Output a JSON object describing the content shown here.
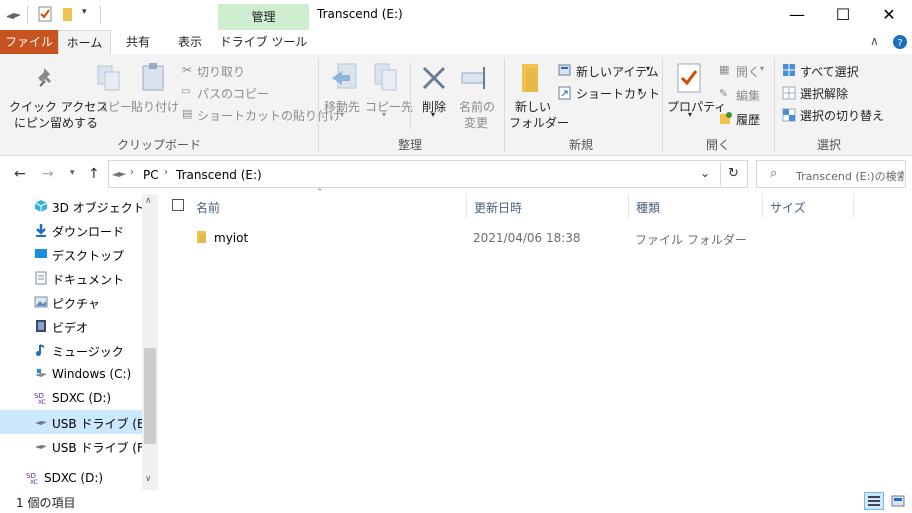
{
  "window": {
    "title": "Transcend (E:)",
    "context_tab_group": "管理",
    "minimize": "—",
    "maximize": "☐",
    "close": "✕"
  },
  "tabs": {
    "file": "ファイル",
    "home": "ホーム",
    "share": "共有",
    "view": "表示",
    "drive_tools": "ドライブ ツール"
  },
  "ribbon": {
    "clipboard": {
      "pin_line1": "クイック アクセス",
      "pin_line2": "にピン留めする",
      "copy": "コピー",
      "paste": "貼り付け",
      "cut": "切り取り",
      "copy_path": "パスのコピー",
      "paste_shortcut": "ショートカットの貼り付け",
      "group": "クリップボード"
    },
    "organize": {
      "move_to": "移動先",
      "copy_to": "コピー先",
      "delete": "削除",
      "rename_line1": "名前の",
      "rename_line2": "変更",
      "group": "整理"
    },
    "new": {
      "new_folder_line1": "新しい",
      "new_folder_line2": "フォルダー",
      "new_item": "新しいアイテム",
      "shortcut": "ショートカット",
      "group": "新規"
    },
    "open": {
      "properties": "プロパティ",
      "open": "開く",
      "edit": "編集",
      "history": "履歴",
      "group": "開く"
    },
    "select": {
      "select_all": "すべて選択",
      "select_none": "選択解除",
      "invert": "選択の切り替え",
      "group": "選択"
    }
  },
  "address": {
    "crumb_pc": "PC",
    "crumb_drive": "Transcend (E:)",
    "search_placeholder": "Transcend (E:)の検索"
  },
  "nav": [
    {
      "label": "3D オブジェクト",
      "icon": "cube-icon"
    },
    {
      "label": "ダウンロード",
      "icon": "download-icon"
    },
    {
      "label": "デスクトップ",
      "icon": "desktop-icon"
    },
    {
      "label": "ドキュメント",
      "icon": "document-icon"
    },
    {
      "label": "ピクチャ",
      "icon": "picture-icon"
    },
    {
      "label": "ビデオ",
      "icon": "video-icon"
    },
    {
      "label": "ミュージック",
      "icon": "music-icon"
    },
    {
      "label": "Windows (C:)",
      "icon": "windows-drive-icon"
    },
    {
      "label": "SDXC (D:)",
      "icon": "sdxc-icon"
    },
    {
      "label": "USB ドライブ (E:)",
      "icon": "usb-drive-icon",
      "selected": true
    },
    {
      "label": "USB ドライブ (F:)",
      "icon": "usb-drive-icon"
    },
    {
      "label": "SDXC (D:)",
      "icon": "sdxc-icon"
    }
  ],
  "columns": {
    "name": "名前",
    "modified": "更新日時",
    "type": "種類",
    "size": "サイズ"
  },
  "files": [
    {
      "name": "myiot",
      "modified": "2021/04/06 18:38",
      "type": "ファイル フォルダー",
      "size": ""
    }
  ],
  "status": {
    "count": "1 個の項目"
  },
  "colors": {
    "file_tab": "#c8531e",
    "context_tab": "#cfeecf",
    "selection": "#cce8ff",
    "folder": "#e8b84a"
  }
}
